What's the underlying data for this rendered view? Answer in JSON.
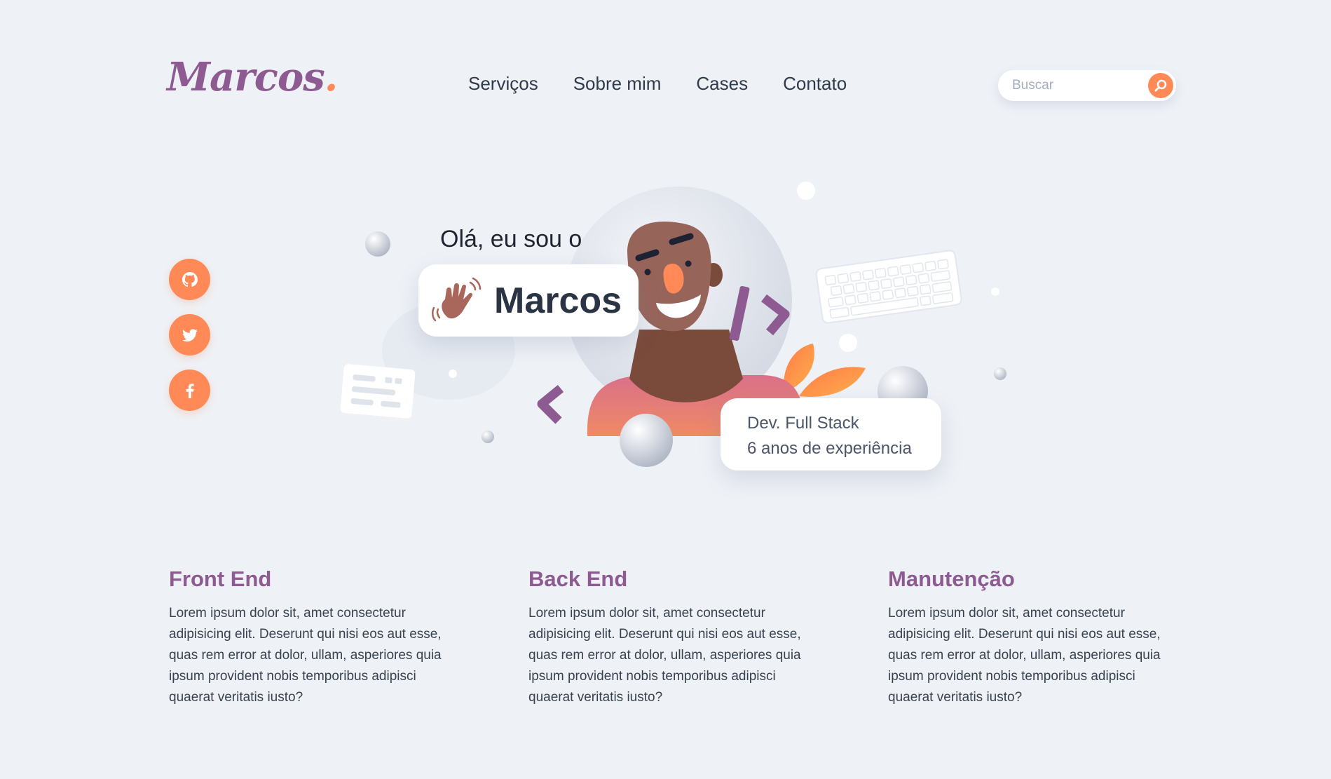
{
  "header": {
    "logo_text": "Marcos",
    "logo_dot": ".",
    "nav": [
      {
        "label": "Serviços"
      },
      {
        "label": "Sobre mim"
      },
      {
        "label": "Cases"
      },
      {
        "label": "Contato"
      }
    ],
    "search": {
      "placeholder": "Buscar",
      "icon": "search-icon"
    }
  },
  "social": [
    {
      "name": "github",
      "icon": "github-icon"
    },
    {
      "name": "twitter",
      "icon": "twitter-icon"
    },
    {
      "name": "facebook",
      "icon": "facebook-icon"
    }
  ],
  "hero": {
    "greeting": "Olá, eu sou o",
    "name": "Marcos",
    "role": "Dev. Full Stack",
    "experience": "6 anos de experiência"
  },
  "services": [
    {
      "title": "Front End",
      "description": "Lorem ipsum dolor sit, amet consectetur adipisicing elit. Deserunt qui nisi eos aut esse, quas rem error at dolor, ullam, asperiores quia ipsum provident nobis temporibus adipisci quaerat veritatis iusto?"
    },
    {
      "title": "Back End",
      "description": "Lorem ipsum dolor sit, amet consectetur adipisicing elit. Deserunt qui nisi eos aut esse, quas rem error at dolor, ullam, asperiores quia ipsum provident nobis temporibus adipisci quaerat veritatis iusto?"
    },
    {
      "title": "Manutenção",
      "description": "Lorem ipsum dolor sit, amet consectetur adipisicing elit. Deserunt qui nisi eos aut esse, quas rem error at dolor, ullam, asperiores quia ipsum provident nobis temporibus adipisci quaerat veritatis iusto?"
    }
  ],
  "colors": {
    "background": "#eef1f6",
    "accent": "#ff8a57",
    "brand": "#8d5a91",
    "text": "#2f3a4a"
  }
}
